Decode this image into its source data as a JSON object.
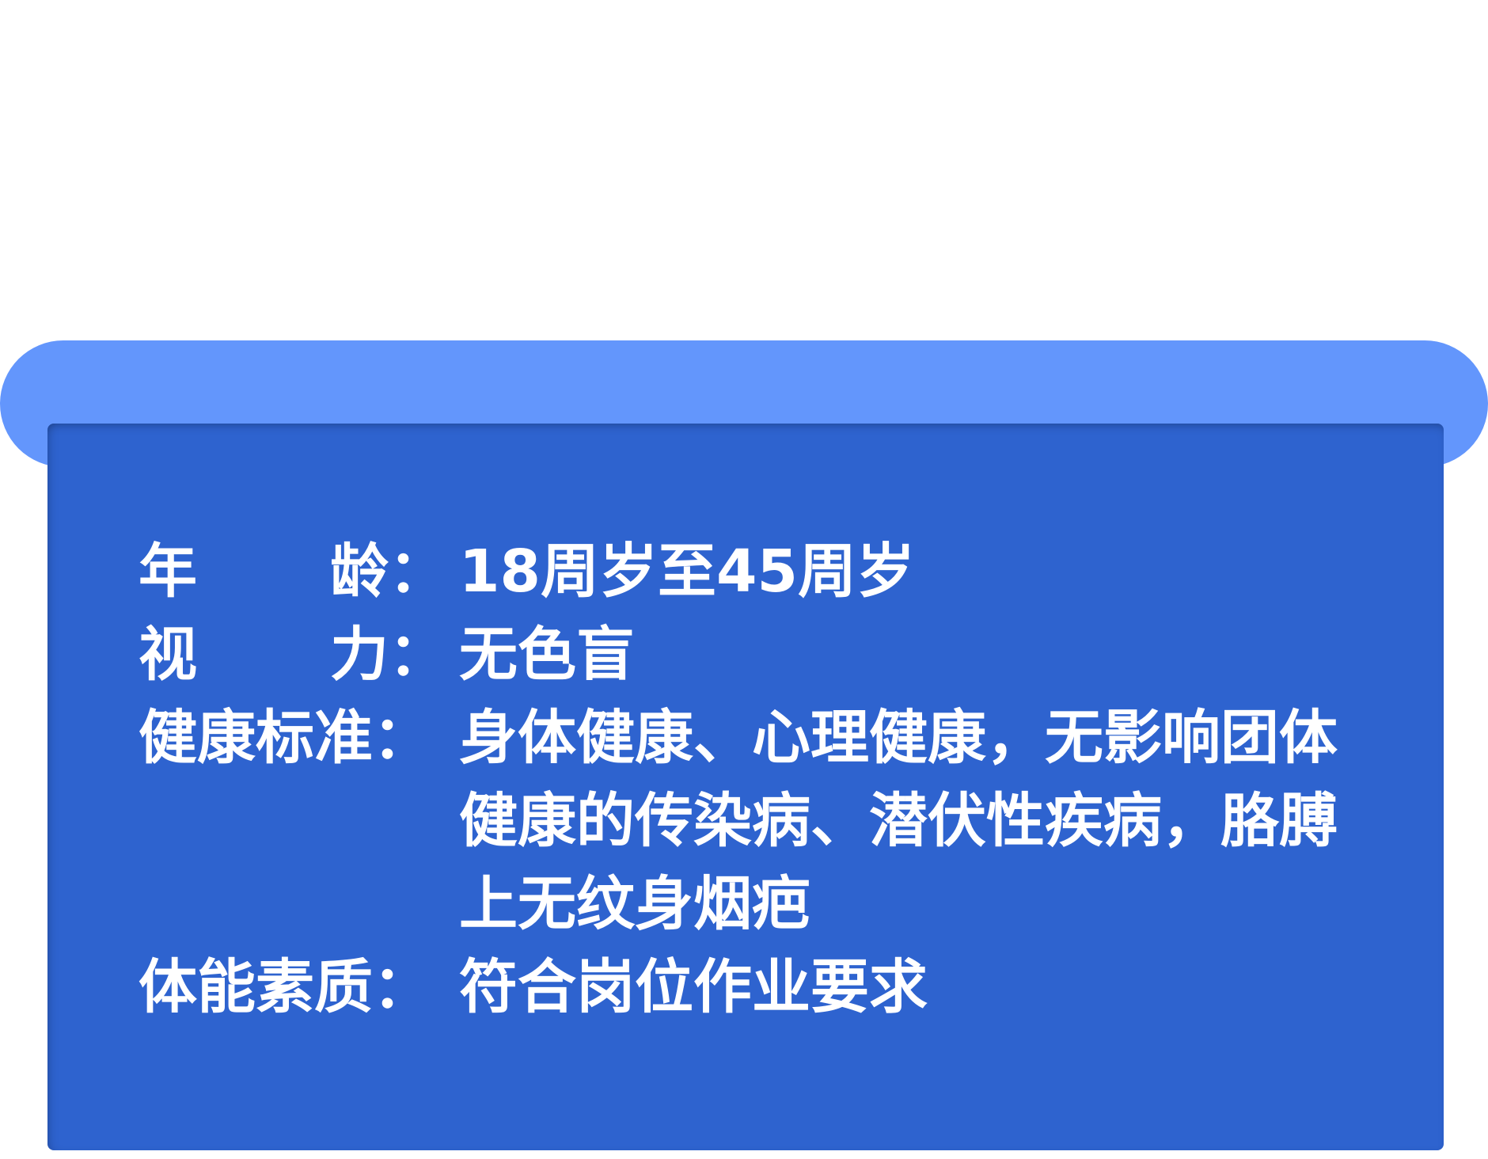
{
  "requirements": [
    {
      "label_a": "年",
      "label_b": "龄：",
      "value": "18周岁至45周岁"
    },
    {
      "label_a": "视",
      "label_b": "力：",
      "value": "无色盲"
    },
    {
      "label": "健康标准：",
      "value": "身体健康、心理健康，无影响团体健康的传染病、潜伏性疾病，胳膊上无纹身烟疤"
    },
    {
      "label": "体能素质：",
      "value": "符合岗位作业要求"
    }
  ],
  "colors": {
    "tab": "#6396fc",
    "card": "#2e63cf",
    "text": "#ffffff"
  }
}
